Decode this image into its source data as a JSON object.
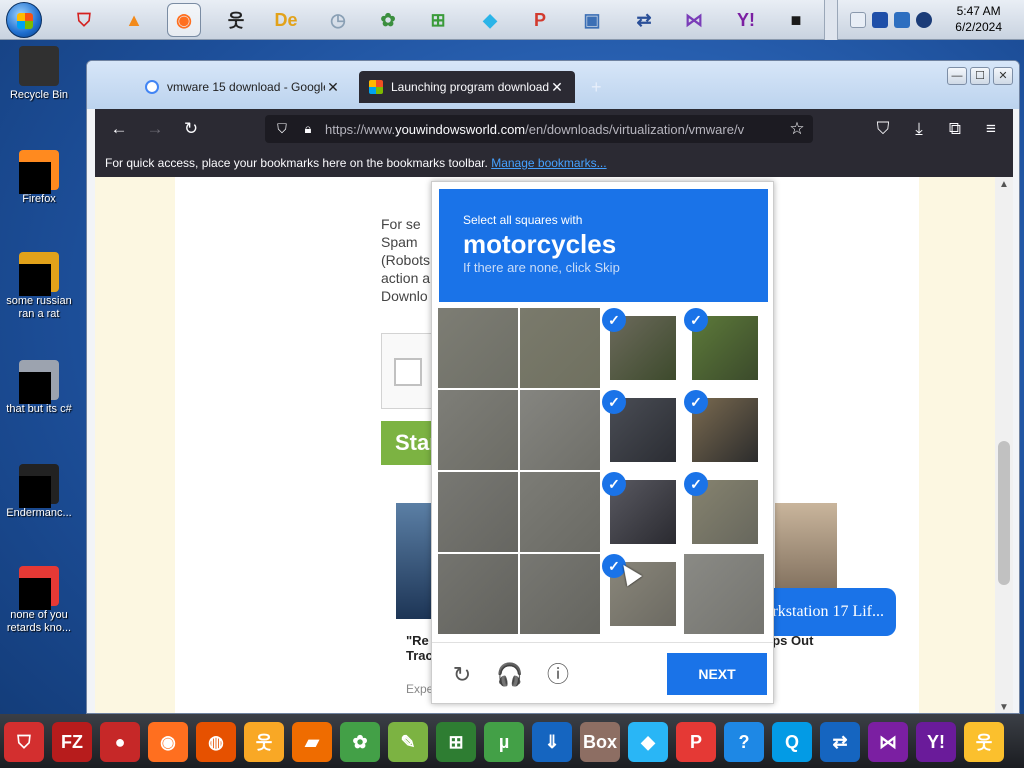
{
  "topbar": {
    "icons": [
      {
        "name": "adobe-reader-icon",
        "glyph": "⛉",
        "color": "#d4201f"
      },
      {
        "name": "vlc-icon",
        "glyph": "▲",
        "color": "#f28a1b"
      },
      {
        "name": "firefox-icon",
        "glyph": "◉",
        "color": "#ff6f1f"
      },
      {
        "name": "runner-icon",
        "glyph": "웃",
        "color": "#222222"
      },
      {
        "name": "de-app-icon",
        "glyph": "De",
        "color": "#e2a21a"
      },
      {
        "name": "clock-icon",
        "glyph": "◷",
        "color": "#8aa0b5"
      },
      {
        "name": "flower-icon",
        "glyph": "✿",
        "color": "#3b8f3f"
      },
      {
        "name": "windows-icon",
        "glyph": "⊞",
        "color": "#3a9b3a"
      },
      {
        "name": "diamond-icon",
        "glyph": "◆",
        "color": "#2bb4e8"
      },
      {
        "name": "p-app-icon",
        "glyph": "P",
        "color": "#d23a2e"
      },
      {
        "name": "monitor-app-icon",
        "glyph": "▣",
        "color": "#3b6fb5"
      },
      {
        "name": "remote-app-icon",
        "glyph": "⇄",
        "color": "#2a4f98"
      },
      {
        "name": "visual-studio-icon",
        "glyph": "⋈",
        "color": "#7a3db8"
      },
      {
        "name": "yahoo-messenger-icon",
        "glyph": "Y!",
        "color": "#7b1fa2"
      },
      {
        "name": "black-box-icon",
        "glyph": "■",
        "color": "#1a1a1a"
      }
    ],
    "clock": {
      "time": "5:47 AM",
      "date": "6/2/2024"
    }
  },
  "desktop": {
    "icons": [
      {
        "label": "Recycle Bin",
        "color": "#303030"
      },
      {
        "label": "Firefox",
        "color": "#ff8a1f"
      },
      {
        "label": "some russian ran a rat",
        "color": "#e2a21a"
      },
      {
        "label": "that but its c#",
        "color": "#9ca3af"
      },
      {
        "label": "Endermanc...",
        "color": "#222222"
      },
      {
        "label": "none of you retards kno...",
        "color": "#e53935"
      }
    ]
  },
  "browser": {
    "tabs": [
      {
        "label": "vmware 15 download - Google",
        "favicon_color": "#4285f4"
      },
      {
        "label": "Launching program download",
        "favicon_color": "#f25022"
      }
    ],
    "new_tab": "+",
    "window_buttons": [
      "—",
      "☐",
      "✕"
    ],
    "url": {
      "prefix": "https://www.",
      "domain": "youwindowsworld.com",
      "path": "/en/downloads/virtualization/vmware/v"
    },
    "bookmarks_bar": {
      "text": "For quick access, place your bookmarks here on the bookmarks toolbar.",
      "link": "Manage bookmarks..."
    }
  },
  "page": {
    "text_lines": [
      "For se",
      "Spam",
      "(Robots",
      "action a",
      "Downlo"
    ],
    "start_button": "Star",
    "article_left": {
      "title_top": "\"Re",
      "title_bottom": "Trac",
      "sub": "Expe"
    },
    "article_right": {
      "title": "eps Out"
    },
    "notice": "VMware Workstation 17 Lif..."
  },
  "captcha": {
    "instruction": "Select all squares with",
    "target": "motorcycles",
    "hint": "If there are none, click Skip",
    "tiles": [
      {
        "selected": false,
        "colors": [
          "#7d7d74",
          "#6e6f66"
        ]
      },
      {
        "selected": false,
        "colors": [
          "#7a7a6c",
          "#6f705f"
        ]
      },
      {
        "selected": true,
        "colors": [
          "#6c6a5c",
          "#3d4a2c"
        ]
      },
      {
        "selected": true,
        "colors": [
          "#5d7a3a",
          "#3b4a2b"
        ]
      },
      {
        "selected": false,
        "colors": [
          "#7e7e78",
          "#6c6c65"
        ]
      },
      {
        "selected": false,
        "colors": [
          "#858580",
          "#6f6f69"
        ]
      },
      {
        "selected": true,
        "colors": [
          "#4a4d55",
          "#2b2d33"
        ]
      },
      {
        "selected": true,
        "colors": [
          "#7a6a50",
          "#2c2c2c"
        ]
      },
      {
        "selected": false,
        "colors": [
          "#787873",
          "#666661"
        ]
      },
      {
        "selected": false,
        "colors": [
          "#7c7c76",
          "#6a6a64"
        ]
      },
      {
        "selected": true,
        "colors": [
          "#595961",
          "#2a2a30"
        ]
      },
      {
        "selected": true,
        "colors": [
          "#86836f",
          "#67675d"
        ]
      },
      {
        "selected": false,
        "colors": [
          "#74746f",
          "#62625d"
        ]
      },
      {
        "selected": false,
        "colors": [
          "#777772",
          "#65655f"
        ]
      },
      {
        "selected": true,
        "colors": [
          "#89867a",
          "#6c6a62"
        ]
      },
      {
        "selected": false,
        "colors": [
          "#8a8a85",
          "#74746f"
        ]
      }
    ],
    "reload_icon": "↻",
    "audio_icon": "🎧",
    "info_icon": "ⓘ",
    "next_label": "NEXT"
  },
  "taskbar": {
    "icons": [
      {
        "name": "pdf-icon",
        "glyph": "⛉",
        "color": "#d32f2f"
      },
      {
        "name": "filezilla-icon",
        "glyph": "FZ",
        "color": "#b71c1c"
      },
      {
        "name": "red-creature-icon",
        "glyph": "●",
        "color": "#c62828"
      },
      {
        "name": "firefox-icon",
        "glyph": "◉",
        "color": "#ff6f1f"
      },
      {
        "name": "orange-ball-icon",
        "glyph": "◍",
        "color": "#e65100"
      },
      {
        "name": "runner-icon",
        "glyph": "웃",
        "color": "#f9a825"
      },
      {
        "name": "orange-app-icon",
        "glyph": "▰",
        "color": "#ef6c00"
      },
      {
        "name": "flower-icon",
        "glyph": "✿",
        "color": "#43a047"
      },
      {
        "name": "green-note-icon",
        "glyph": "✎",
        "color": "#7cb342"
      },
      {
        "name": "windows-icon",
        "glyph": "⊞",
        "color": "#2e7d32"
      },
      {
        "name": "utorrent-icon",
        "glyph": "µ",
        "color": "#43a047"
      },
      {
        "name": "download-app-icon",
        "glyph": "⇓",
        "color": "#1565c0"
      },
      {
        "name": "box-icon",
        "glyph": "Box",
        "color": "#8d6e63"
      },
      {
        "name": "diamond-icon",
        "glyph": "◆",
        "color": "#29b6f6"
      },
      {
        "name": "p-app-icon",
        "glyph": "P",
        "color": "#e53935"
      },
      {
        "name": "help-icon",
        "glyph": "?",
        "color": "#1e88e5"
      },
      {
        "name": "qt-icon",
        "glyph": "Q",
        "color": "#039be5"
      },
      {
        "name": "remote-app-icon",
        "glyph": "⇄",
        "color": "#1565c0"
      },
      {
        "name": "visual-studio-icon",
        "glyph": "⋈",
        "color": "#7b1fa2"
      },
      {
        "name": "yahoo-messenger-icon",
        "glyph": "Y!",
        "color": "#6a1b9a"
      },
      {
        "name": "runner-gold-icon",
        "glyph": "웃",
        "color": "#fbc02d"
      }
    ]
  }
}
